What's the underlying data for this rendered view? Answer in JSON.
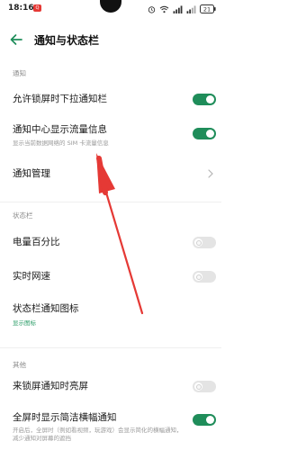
{
  "status_bar": {
    "time": "18:16",
    "notif_badge": "Q",
    "battery_level": "21"
  },
  "header": {
    "title": "通知与状态栏"
  },
  "sections": {
    "notify": {
      "header": "通知"
    },
    "statusbar": {
      "header": "状态栏"
    },
    "other": {
      "header": "其他"
    }
  },
  "settings": {
    "lockscreen_pulldown": {
      "title": "允许锁屏时下拉通知栏",
      "enabled": true
    },
    "data_usage": {
      "title": "通知中心显示流量信息",
      "subtitle": "显示当前数据网络的 SIM 卡流量信息",
      "enabled": true
    },
    "notification_mgmt": {
      "title": "通知管理"
    },
    "battery_percent": {
      "title": "电量百分比",
      "enabled": false
    },
    "net_speed": {
      "title": "实时网速",
      "enabled": false
    },
    "statusbar_icons": {
      "title": "状态栏通知图标",
      "subtitle": "显示图标"
    },
    "lockscreen_wake": {
      "title": "来锁屏通知时亮屏",
      "enabled": false
    },
    "fullscreen_banner": {
      "title": "全屏时显示简洁横幅通知",
      "subtitle": "开启后，全屏时（例如看视频，玩游戏）会显示简化的横幅通知，减少通知对屏幕的遮挡",
      "enabled": true
    }
  },
  "colors": {
    "accent": "#1f8d5a",
    "annotation_arrow": "#e53935"
  },
  "icons": {
    "back": "back-arrow-icon",
    "chevron": "chevron-right-icon",
    "wifi": "wifi-icon",
    "signal": "signal-icon",
    "battery": "battery-icon",
    "alarm": "alarm-icon"
  }
}
